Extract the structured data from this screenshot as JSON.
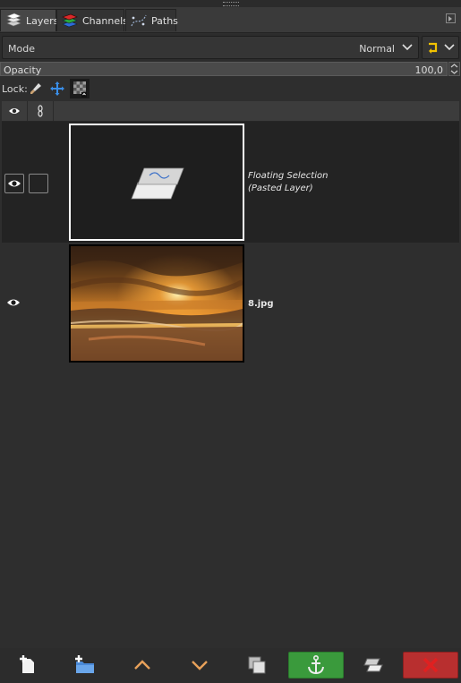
{
  "tabs": [
    {
      "label": "Layers",
      "icon": "layers-icon",
      "active": true
    },
    {
      "label": "Channels",
      "icon": "channels-icon",
      "active": false
    },
    {
      "label": "Paths",
      "icon": "paths-icon",
      "active": false
    }
  ],
  "mode": {
    "label": "Mode",
    "value": "Normal"
  },
  "opacity": {
    "label": "Opacity",
    "value": "100,0"
  },
  "lock": {
    "label": "Lock:"
  },
  "layers": [
    {
      "name_line1": "Floating Selection",
      "name_line2": "(Pasted Layer)",
      "visible": true,
      "selected": true
    },
    {
      "name": "8.jpg",
      "visible": true,
      "selected": false
    }
  ],
  "colors": {
    "accent_green": "#3a9a3c",
    "accent_red": "#b82f2f",
    "anchor_yellow": "#f2c200",
    "lock_position_blue": "#3a8ee8"
  }
}
